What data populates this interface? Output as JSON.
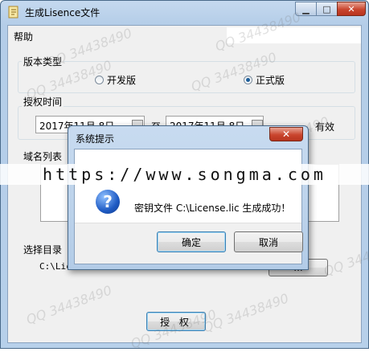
{
  "window": {
    "title": "生成Lisence文件",
    "minimize": "▁",
    "maximize": "□",
    "close": "✕"
  },
  "menu": {
    "help": "帮助"
  },
  "version": {
    "label": "版本类型",
    "dev": "开发版",
    "official": "正式版",
    "selected": "official"
  },
  "auth_time": {
    "label": "授权时间",
    "start": "2017年11月 8日",
    "separator": "至",
    "end": "2017年11月 8日",
    "suffix": "有效"
  },
  "domains": {
    "label": "域名列表"
  },
  "directory": {
    "label": "选择目录",
    "value": "C:\\License.lic",
    "browse": "..."
  },
  "authorize_button": "授 权",
  "dialog": {
    "title": "系统提示",
    "close": "✕",
    "icon": "question-icon",
    "message": "密钥文件 C:\\License.lic 生成成功！",
    "ok": "确定",
    "cancel": "取消"
  },
  "overlay_url": "https://www.songma.com",
  "watermark": "QQ 34438490",
  "colors": {
    "titlebar": "#b9d1ea",
    "close": "#c9452e",
    "accent": "#3c7fb1"
  }
}
